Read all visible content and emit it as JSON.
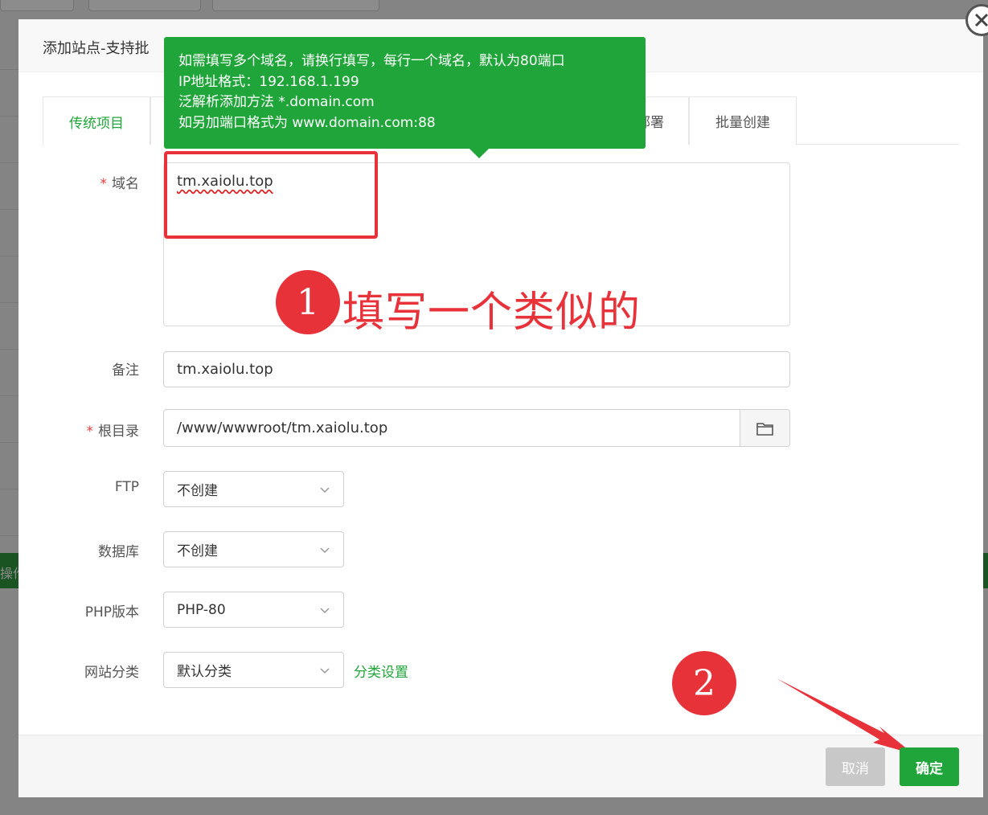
{
  "dialog": {
    "title": "添加站点-支持批",
    "tabs": [
      {
        "label": "传统项目",
        "active": true
      },
      {
        "label": "部署",
        "active": false
      },
      {
        "label": "批量创建",
        "active": false
      }
    ]
  },
  "tooltip": {
    "lines": [
      "如需填写多个域名，请换行填写，每行一个域名，默认为80端口",
      "IP地址格式：192.168.1.199",
      "泛解析添加方法 *.domain.com",
      "如另加端口格式为 www.domain.com:88"
    ]
  },
  "form": {
    "domain": {
      "label": "域名",
      "value": "tm.xaiolu.top"
    },
    "remark": {
      "label": "备注",
      "value": "tm.xaiolu.top"
    },
    "root": {
      "label": "根目录",
      "value": "/www/wwwroot/tm.xaiolu.top"
    },
    "ftp": {
      "label": "FTP",
      "value": "不创建"
    },
    "database": {
      "label": "数据库",
      "value": "不创建"
    },
    "php": {
      "label": "PHP版本",
      "value": "PHP-80"
    },
    "category": {
      "label": "网站分类",
      "value": "默认分类",
      "link": "分类设置"
    }
  },
  "annotations": {
    "step1_num": "1",
    "step1_text": "填写一个类似的",
    "step2_num": "2"
  },
  "buttons": {
    "cancel": "取消",
    "ok": "确定"
  },
  "background": {
    "ops_label": "操作"
  },
  "colors": {
    "accent": "#20a53a",
    "annotation": "#e8323a"
  }
}
